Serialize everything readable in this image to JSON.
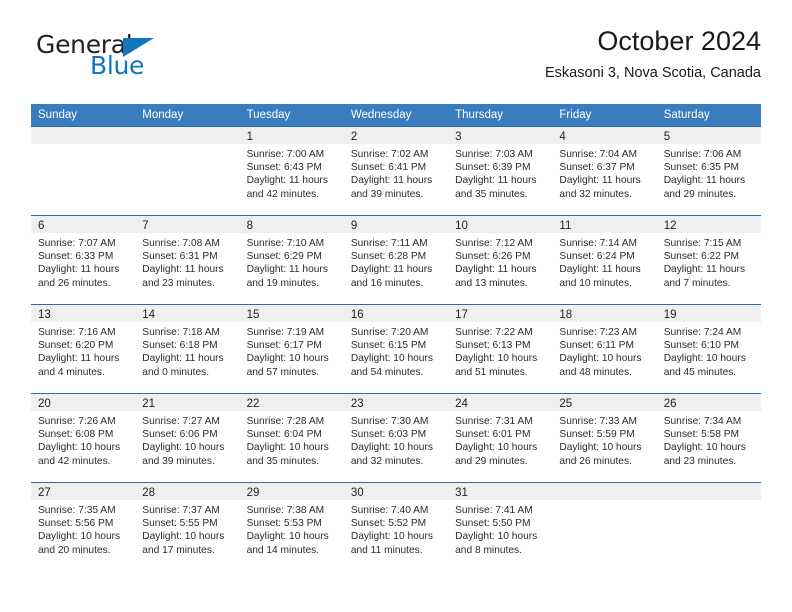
{
  "brand": {
    "word1": "General",
    "word2": "Blue",
    "accent_color": "#1474bc"
  },
  "header": {
    "title": "October 2024",
    "location": "Eskasoni 3, Nova Scotia, Canada"
  },
  "calendar": {
    "header_bg": "#3a7dbf",
    "row_divider": "#2b6cb0",
    "daynum_bg": "#efefef",
    "weekdays": [
      "Sunday",
      "Monday",
      "Tuesday",
      "Wednesday",
      "Thursday",
      "Friday",
      "Saturday"
    ],
    "weeks": [
      [
        {
          "day": "",
          "sunrise": "",
          "sunset": "",
          "daylight_1": "",
          "daylight_2": ""
        },
        {
          "day": "",
          "sunrise": "",
          "sunset": "",
          "daylight_1": "",
          "daylight_2": ""
        },
        {
          "day": "1",
          "sunrise": "Sunrise: 7:00 AM",
          "sunset": "Sunset: 6:43 PM",
          "daylight_1": "Daylight: 11 hours",
          "daylight_2": "and 42 minutes."
        },
        {
          "day": "2",
          "sunrise": "Sunrise: 7:02 AM",
          "sunset": "Sunset: 6:41 PM",
          "daylight_1": "Daylight: 11 hours",
          "daylight_2": "and 39 minutes."
        },
        {
          "day": "3",
          "sunrise": "Sunrise: 7:03 AM",
          "sunset": "Sunset: 6:39 PM",
          "daylight_1": "Daylight: 11 hours",
          "daylight_2": "and 35 minutes."
        },
        {
          "day": "4",
          "sunrise": "Sunrise: 7:04 AM",
          "sunset": "Sunset: 6:37 PM",
          "daylight_1": "Daylight: 11 hours",
          "daylight_2": "and 32 minutes."
        },
        {
          "day": "5",
          "sunrise": "Sunrise: 7:06 AM",
          "sunset": "Sunset: 6:35 PM",
          "daylight_1": "Daylight: 11 hours",
          "daylight_2": "and 29 minutes."
        }
      ],
      [
        {
          "day": "6",
          "sunrise": "Sunrise: 7:07 AM",
          "sunset": "Sunset: 6:33 PM",
          "daylight_1": "Daylight: 11 hours",
          "daylight_2": "and 26 minutes."
        },
        {
          "day": "7",
          "sunrise": "Sunrise: 7:08 AM",
          "sunset": "Sunset: 6:31 PM",
          "daylight_1": "Daylight: 11 hours",
          "daylight_2": "and 23 minutes."
        },
        {
          "day": "8",
          "sunrise": "Sunrise: 7:10 AM",
          "sunset": "Sunset: 6:29 PM",
          "daylight_1": "Daylight: 11 hours",
          "daylight_2": "and 19 minutes."
        },
        {
          "day": "9",
          "sunrise": "Sunrise: 7:11 AM",
          "sunset": "Sunset: 6:28 PM",
          "daylight_1": "Daylight: 11 hours",
          "daylight_2": "and 16 minutes."
        },
        {
          "day": "10",
          "sunrise": "Sunrise: 7:12 AM",
          "sunset": "Sunset: 6:26 PM",
          "daylight_1": "Daylight: 11 hours",
          "daylight_2": "and 13 minutes."
        },
        {
          "day": "11",
          "sunrise": "Sunrise: 7:14 AM",
          "sunset": "Sunset: 6:24 PM",
          "daylight_1": "Daylight: 11 hours",
          "daylight_2": "and 10 minutes."
        },
        {
          "day": "12",
          "sunrise": "Sunrise: 7:15 AM",
          "sunset": "Sunset: 6:22 PM",
          "daylight_1": "Daylight: 11 hours",
          "daylight_2": "and 7 minutes."
        }
      ],
      [
        {
          "day": "13",
          "sunrise": "Sunrise: 7:16 AM",
          "sunset": "Sunset: 6:20 PM",
          "daylight_1": "Daylight: 11 hours",
          "daylight_2": "and 4 minutes."
        },
        {
          "day": "14",
          "sunrise": "Sunrise: 7:18 AM",
          "sunset": "Sunset: 6:18 PM",
          "daylight_1": "Daylight: 11 hours",
          "daylight_2": "and 0 minutes."
        },
        {
          "day": "15",
          "sunrise": "Sunrise: 7:19 AM",
          "sunset": "Sunset: 6:17 PM",
          "daylight_1": "Daylight: 10 hours",
          "daylight_2": "and 57 minutes."
        },
        {
          "day": "16",
          "sunrise": "Sunrise: 7:20 AM",
          "sunset": "Sunset: 6:15 PM",
          "daylight_1": "Daylight: 10 hours",
          "daylight_2": "and 54 minutes."
        },
        {
          "day": "17",
          "sunrise": "Sunrise: 7:22 AM",
          "sunset": "Sunset: 6:13 PM",
          "daylight_1": "Daylight: 10 hours",
          "daylight_2": "and 51 minutes."
        },
        {
          "day": "18",
          "sunrise": "Sunrise: 7:23 AM",
          "sunset": "Sunset: 6:11 PM",
          "daylight_1": "Daylight: 10 hours",
          "daylight_2": "and 48 minutes."
        },
        {
          "day": "19",
          "sunrise": "Sunrise: 7:24 AM",
          "sunset": "Sunset: 6:10 PM",
          "daylight_1": "Daylight: 10 hours",
          "daylight_2": "and 45 minutes."
        }
      ],
      [
        {
          "day": "20",
          "sunrise": "Sunrise: 7:26 AM",
          "sunset": "Sunset: 6:08 PM",
          "daylight_1": "Daylight: 10 hours",
          "daylight_2": "and 42 minutes."
        },
        {
          "day": "21",
          "sunrise": "Sunrise: 7:27 AM",
          "sunset": "Sunset: 6:06 PM",
          "daylight_1": "Daylight: 10 hours",
          "daylight_2": "and 39 minutes."
        },
        {
          "day": "22",
          "sunrise": "Sunrise: 7:28 AM",
          "sunset": "Sunset: 6:04 PM",
          "daylight_1": "Daylight: 10 hours",
          "daylight_2": "and 35 minutes."
        },
        {
          "day": "23",
          "sunrise": "Sunrise: 7:30 AM",
          "sunset": "Sunset: 6:03 PM",
          "daylight_1": "Daylight: 10 hours",
          "daylight_2": "and 32 minutes."
        },
        {
          "day": "24",
          "sunrise": "Sunrise: 7:31 AM",
          "sunset": "Sunset: 6:01 PM",
          "daylight_1": "Daylight: 10 hours",
          "daylight_2": "and 29 minutes."
        },
        {
          "day": "25",
          "sunrise": "Sunrise: 7:33 AM",
          "sunset": "Sunset: 5:59 PM",
          "daylight_1": "Daylight: 10 hours",
          "daylight_2": "and 26 minutes."
        },
        {
          "day": "26",
          "sunrise": "Sunrise: 7:34 AM",
          "sunset": "Sunset: 5:58 PM",
          "daylight_1": "Daylight: 10 hours",
          "daylight_2": "and 23 minutes."
        }
      ],
      [
        {
          "day": "27",
          "sunrise": "Sunrise: 7:35 AM",
          "sunset": "Sunset: 5:56 PM",
          "daylight_1": "Daylight: 10 hours",
          "daylight_2": "and 20 minutes."
        },
        {
          "day": "28",
          "sunrise": "Sunrise: 7:37 AM",
          "sunset": "Sunset: 5:55 PM",
          "daylight_1": "Daylight: 10 hours",
          "daylight_2": "and 17 minutes."
        },
        {
          "day": "29",
          "sunrise": "Sunrise: 7:38 AM",
          "sunset": "Sunset: 5:53 PM",
          "daylight_1": "Daylight: 10 hours",
          "daylight_2": "and 14 minutes."
        },
        {
          "day": "30",
          "sunrise": "Sunrise: 7:40 AM",
          "sunset": "Sunset: 5:52 PM",
          "daylight_1": "Daylight: 10 hours",
          "daylight_2": "and 11 minutes."
        },
        {
          "day": "31",
          "sunrise": "Sunrise: 7:41 AM",
          "sunset": "Sunset: 5:50 PM",
          "daylight_1": "Daylight: 10 hours",
          "daylight_2": "and 8 minutes."
        },
        {
          "day": "",
          "sunrise": "",
          "sunset": "",
          "daylight_1": "",
          "daylight_2": ""
        },
        {
          "day": "",
          "sunrise": "",
          "sunset": "",
          "daylight_1": "",
          "daylight_2": ""
        }
      ]
    ]
  }
}
